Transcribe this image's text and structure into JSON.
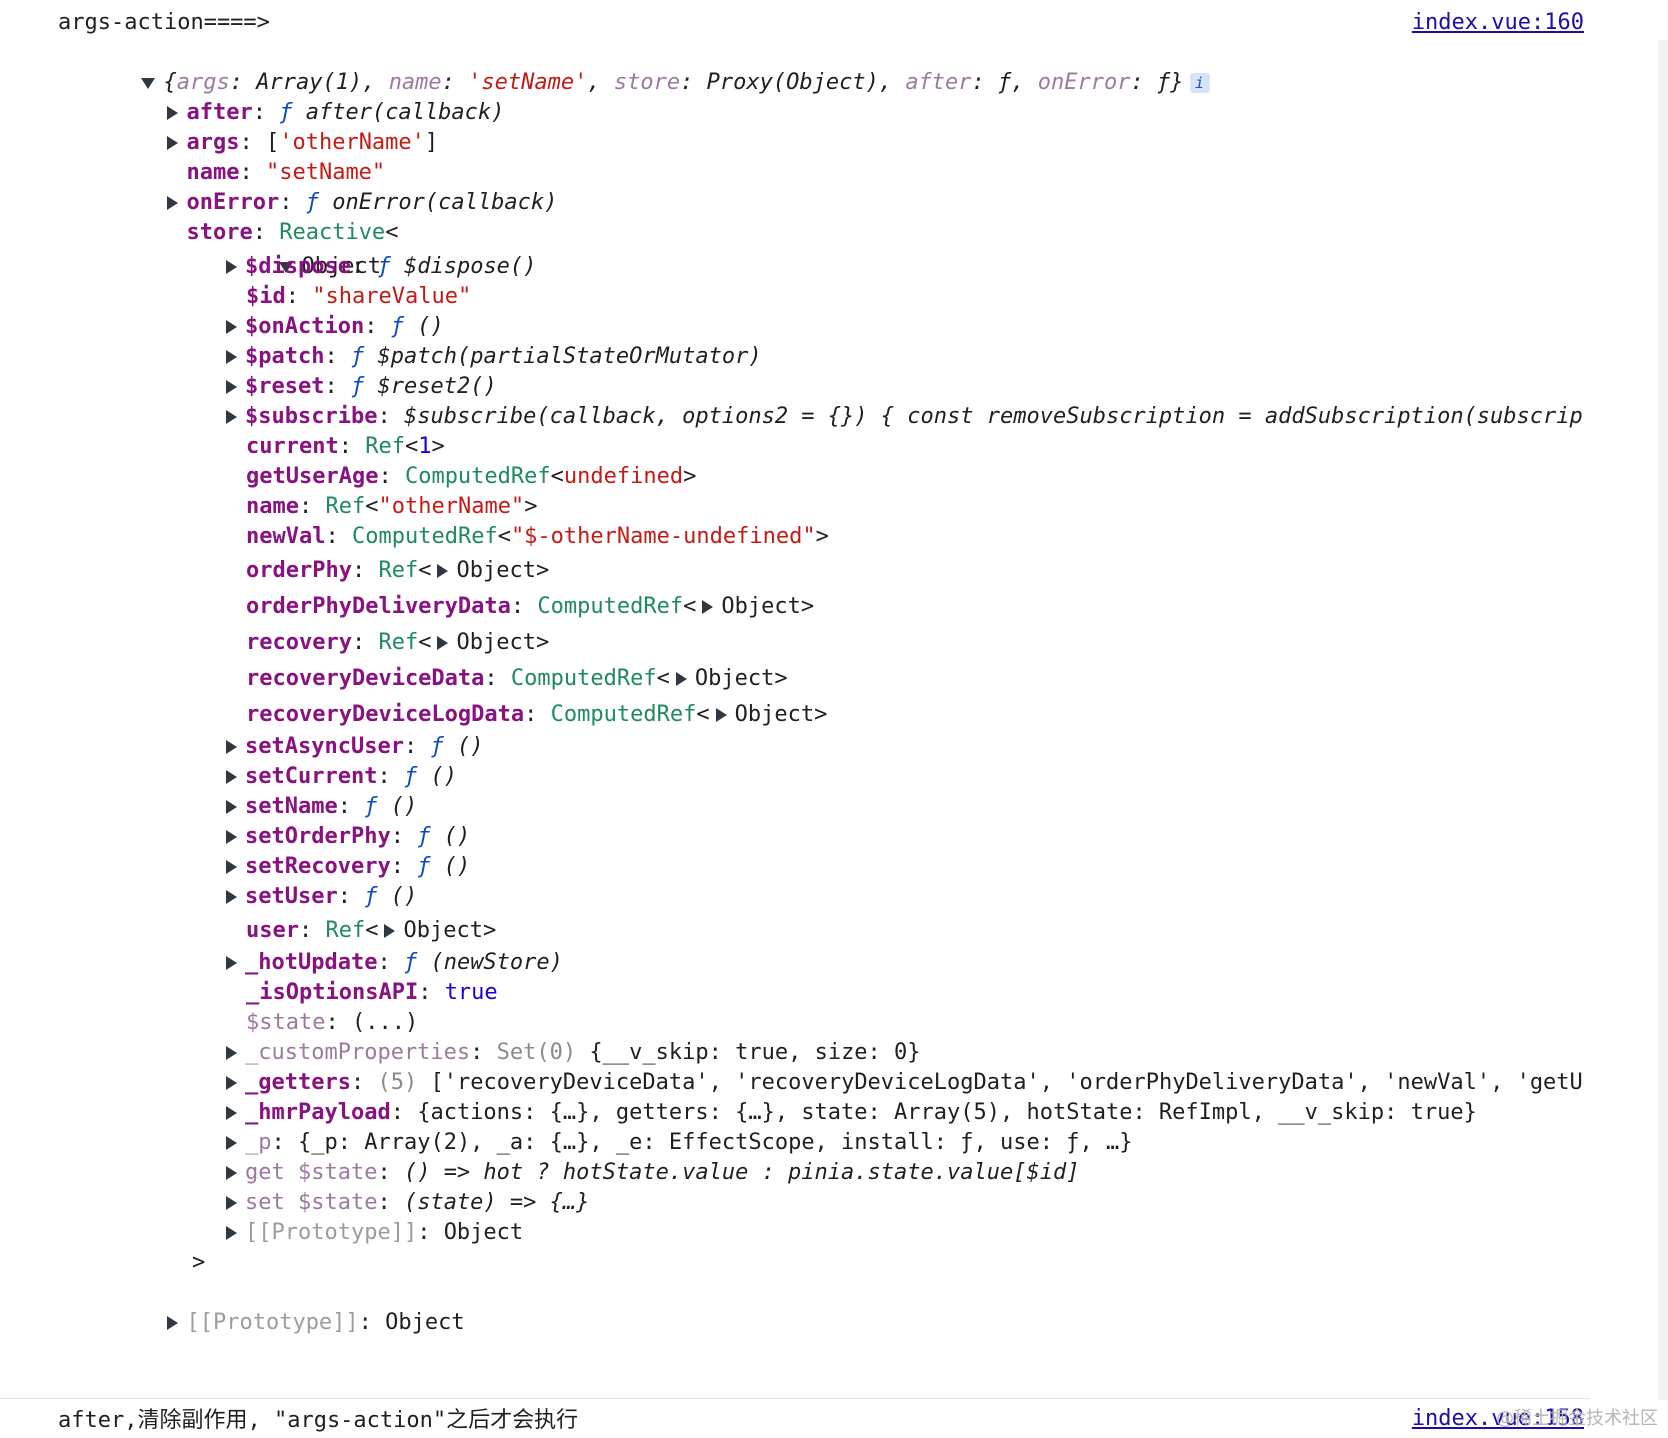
{
  "msg1": {
    "label": "args-action====>",
    "source": "index.vue:160"
  },
  "summary": {
    "open": "{",
    "k_args": "args",
    "v_args": "Array(1)",
    "k_name": "name",
    "v_name": "'setName'",
    "k_store": "store",
    "v_store": "Proxy(Object)",
    "k_after": "after",
    "v_after": "ƒ",
    "k_onerror": "onError",
    "v_onerror": "ƒ}",
    "info": "i"
  },
  "props": {
    "after": {
      "key": "after",
      "fn": "ƒ",
      "sig": "after(callback)"
    },
    "args": {
      "key": "args",
      "open": "[",
      "val": "'otherName'",
      "close": "]"
    },
    "name": {
      "key": "name",
      "val": "\"setName\""
    },
    "onError": {
      "key": "onError",
      "fn": "ƒ",
      "sig": "onError(callback)"
    },
    "store": {
      "key": "store",
      "type": "Reactive",
      "lt": "<"
    }
  },
  "store_obj": {
    "label": "Object",
    "rows": [
      {
        "key": "$dispose",
        "fn": "ƒ",
        "sig": "$dispose()"
      },
      {
        "key": "$id",
        "str": "\"shareValue\""
      },
      {
        "key": "$onAction",
        "fn": "ƒ",
        "sig": "()"
      },
      {
        "key": "$patch",
        "fn": "ƒ",
        "sig": "$patch(partialStateOrMutator)"
      },
      {
        "key": "$reset",
        "fn": "ƒ",
        "sig": "$reset2()"
      },
      {
        "key": "$subscribe",
        "sig": "$subscribe(callback, options2 = {}) { const removeSubscription = addSubscription(subscrip"
      },
      {
        "key": "current",
        "type": "Ref",
        "lt": "<",
        "num": "1",
        "gt": ">"
      },
      {
        "key": "getUserAge",
        "type": "ComputedRef",
        "lt": "<",
        "str": "undefined",
        "gt": ">"
      },
      {
        "key": "name",
        "type": "Ref",
        "lt": "<",
        "str": "\"otherName\"",
        "gt": ">"
      },
      {
        "key": "newVal",
        "type": "ComputedRef",
        "lt": "<",
        "str": "\"$-otherName-undefined\"",
        "gt": ">"
      },
      {
        "key": "orderPhy",
        "type": "Ref",
        "lt": "<",
        "obj": "Object>"
      },
      {
        "key": "orderPhyDeliveryData",
        "type": "ComputedRef",
        "lt": "<",
        "obj": "Object>"
      },
      {
        "key": "recovery",
        "type": "Ref",
        "lt": "<",
        "obj": "Object>"
      },
      {
        "key": "recoveryDeviceData",
        "type": "ComputedRef",
        "lt": "<",
        "obj": "Object>"
      },
      {
        "key": "recoveryDeviceLogData",
        "type": "ComputedRef",
        "lt": "<",
        "obj": "Object>"
      },
      {
        "key": "setAsyncUser",
        "fn": "ƒ",
        "sig": "()"
      },
      {
        "key": "setCurrent",
        "fn": "ƒ",
        "sig": "()"
      },
      {
        "key": "setName",
        "fn": "ƒ",
        "sig": "()"
      },
      {
        "key": "setOrderPhy",
        "fn": "ƒ",
        "sig": "()"
      },
      {
        "key": "setRecovery",
        "fn": "ƒ",
        "sig": "()"
      },
      {
        "key": "setUser",
        "fn": "ƒ",
        "sig": "()"
      },
      {
        "key": "user",
        "type": "Ref",
        "lt": "<",
        "obj": "Object>"
      },
      {
        "key": "_hotUpdate",
        "fn": "ƒ",
        "sig": "(newStore)"
      },
      {
        "key": "_isOptionsAPI",
        "bool": "true"
      },
      {
        "key": "$state",
        "plain": "(...)"
      },
      {
        "key": "_customProperties",
        "dim": "Set(0)",
        "plain": "{__v_skip: true, size: 0}"
      },
      {
        "key": "_getters",
        "dim": "(5)",
        "plain": "['recoveryDeviceData', 'recoveryDeviceLogData', 'orderPhyDeliveryData', 'newVal', 'getU"
      },
      {
        "key": "_hmrPayload",
        "plain": "{actions: {…}, getters: {…}, state: Array(5), hotState: RefImpl, __v_skip: true}"
      },
      {
        "key": "_p",
        "plain": "{_p: Array(2), _a: {…}, _e: EffectScope, install: ƒ, use: ƒ, …}"
      },
      {
        "key": "get $state",
        "sig": "() => hot ? hotState.value : pinia.state.value[$id]"
      },
      {
        "key": "set $state",
        "sig": "(state) => {…}"
      },
      {
        "key": "[[Prototype]]",
        "plain": "Object"
      }
    ],
    "close": ">"
  },
  "proto": {
    "key": "[[Prototype]]",
    "val": "Object"
  },
  "msg2": {
    "text": "after,清除副作用, \"args-action\"之后才会执行",
    "source": "index.vue:158"
  },
  "watermark": "@稀土掘金技术社区"
}
